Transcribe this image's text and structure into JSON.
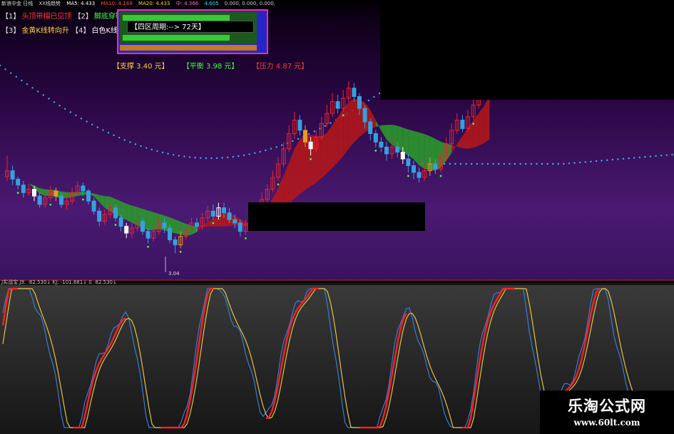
{
  "toolbar": {
    "parts": [
      {
        "text": "新浪中金 日线",
        "color": "#dddddd"
      },
      {
        "text": "XX线趋势",
        "color": "#dddddd"
      },
      {
        "text": "MA5: 4.433",
        "color": "#ffffff"
      },
      {
        "text": "MA10: 4.169",
        "color": "#ff4a4a"
      },
      {
        "text": "MA20: 4.433",
        "color": "#ffd700"
      },
      {
        "text": "中: 4.366",
        "color": "#ff66cc"
      },
      {
        "text": "4.605",
        "color": "#00e5ff"
      },
      {
        "text": "0.000, 0.000, 0.000,",
        "color": "#cccccc"
      }
    ]
  },
  "legend": [
    {
      "key": "【1】",
      "text": "头顶带帽已见顶",
      "color": "#ff3b3b"
    },
    {
      "key": "【2】",
      "text": "脚底穿鞋跌势",
      "color": "#3cff3c"
    },
    {
      "key": "【3】",
      "text": "金黄K线转向升",
      "color": "#ffd23a"
    },
    {
      "key": "【4】",
      "text": "白色K线转向跌",
      "color": "#ffffff"
    }
  ],
  "cycle": {
    "label": "【四区周期:-->  72天】"
  },
  "levels": [
    {
      "text": "【支撑 3.40 元】",
      "color": "#ffd23a"
    },
    {
      "text": "【平衡 3.98 元】",
      "color": "#3cff3c"
    },
    {
      "text": "【压力 4.87 元】",
      "color": "#ff3b3b"
    }
  ],
  "low_mark": "3.04",
  "oscillator": {
    "label": "J实战宝 J9: -82.530↓ KJ: -101.681↓ 0 -82.530↓"
  },
  "watermark": {
    "title": "乐淘公式网",
    "url": "www.60lt.com"
  },
  "colors": {
    "up": "#e8242f",
    "down": "#35a0e0",
    "white": "#ffffff",
    "gold": "#e89a28",
    "ribbon_bull": "#b81818",
    "ribbon_bear": "#2aa02a",
    "dots": "#3ab0ff",
    "osc_red": "#ff2020",
    "osc_blue": "#3a7ad8",
    "osc_yellow": "#e8c23a"
  },
  "chart_data": {
    "type": "candlestick",
    "title": "",
    "price_range": [
      2.9,
      5.2
    ],
    "candles": [
      [
        3.95,
        4.02,
        4.2,
        3.9
      ],
      [
        4.02,
        3.92,
        4.08,
        3.85
      ],
      [
        3.92,
        3.85,
        3.95,
        3.8
      ],
      [
        3.85,
        3.76,
        3.9,
        3.7
      ],
      [
        3.76,
        3.8,
        3.86,
        3.72
      ],
      [
        3.8,
        3.72,
        3.84,
        3.66
      ],
      [
        3.72,
        3.62,
        3.76,
        3.58
      ],
      [
        3.62,
        3.7,
        3.76,
        3.58
      ],
      [
        3.7,
        3.78,
        3.84,
        3.66
      ],
      [
        3.78,
        3.72,
        3.82,
        3.66
      ],
      [
        3.72,
        3.62,
        3.76,
        3.58
      ],
      [
        3.62,
        3.66,
        3.72,
        3.56
      ],
      [
        3.66,
        3.76,
        3.82,
        3.62
      ],
      [
        3.76,
        3.84,
        3.9,
        3.72
      ],
      [
        3.84,
        3.78,
        3.88,
        3.72
      ],
      [
        3.78,
        3.66,
        3.8,
        3.62
      ],
      [
        3.66,
        3.54,
        3.7,
        3.5
      ],
      [
        3.54,
        3.42,
        3.58,
        3.36
      ],
      [
        3.42,
        3.5,
        3.56,
        3.38
      ],
      [
        3.5,
        3.58,
        3.64,
        3.46
      ],
      [
        3.58,
        3.46,
        3.62,
        3.42
      ],
      [
        3.46,
        3.36,
        3.5,
        3.3
      ],
      [
        3.36,
        3.28,
        3.4,
        3.22
      ],
      [
        3.28,
        3.34,
        3.4,
        3.22
      ],
      [
        3.34,
        3.42,
        3.48,
        3.3
      ],
      [
        3.42,
        3.3,
        3.46,
        3.26
      ],
      [
        3.3,
        3.22,
        3.34,
        3.16
      ],
      [
        3.22,
        3.3,
        3.38,
        3.18
      ],
      [
        3.3,
        3.4,
        3.46,
        3.26
      ],
      [
        3.4,
        3.34,
        3.46,
        3.28
      ],
      [
        3.34,
        3.2,
        3.38,
        3.16
      ],
      [
        3.2,
        3.14,
        3.24,
        3.04
      ],
      [
        3.14,
        3.24,
        3.3,
        3.1
      ],
      [
        3.24,
        3.32,
        3.38,
        3.2
      ],
      [
        3.32,
        3.4,
        3.46,
        3.28
      ],
      [
        3.4,
        3.36,
        3.46,
        3.3
      ],
      [
        3.36,
        3.46,
        3.52,
        3.32
      ],
      [
        3.46,
        3.54,
        3.6,
        3.42
      ],
      [
        3.54,
        3.48,
        3.62,
        3.44
      ],
      [
        3.48,
        3.58,
        3.64,
        3.44
      ],
      [
        3.58,
        3.52,
        3.64,
        3.46
      ],
      [
        3.52,
        3.44,
        3.58,
        3.4
      ],
      [
        3.44,
        3.4,
        3.5,
        3.34
      ],
      [
        3.4,
        3.3,
        3.44,
        3.24
      ],
      [
        3.3,
        3.38,
        3.44,
        3.26
      ],
      [
        3.38,
        3.46,
        3.52,
        3.34
      ],
      [
        3.46,
        3.56,
        3.62,
        3.42
      ],
      [
        3.56,
        3.68,
        3.76,
        3.52
      ],
      [
        3.68,
        3.8,
        3.86,
        3.64
      ],
      [
        3.8,
        3.94,
        4.02,
        3.76
      ],
      [
        3.94,
        4.1,
        4.18,
        3.9
      ],
      [
        4.1,
        4.28,
        4.36,
        4.06
      ],
      [
        4.28,
        4.46,
        4.56,
        4.24
      ],
      [
        4.46,
        4.62,
        4.72,
        4.4
      ],
      [
        4.62,
        4.5,
        4.68,
        4.44
      ],
      [
        4.5,
        4.36,
        4.56,
        4.3
      ],
      [
        4.36,
        4.28,
        4.42,
        4.2
      ],
      [
        4.28,
        4.42,
        4.5,
        4.24
      ],
      [
        4.42,
        4.58,
        4.66,
        4.38
      ],
      [
        4.58,
        4.7,
        4.8,
        4.54
      ],
      [
        4.7,
        4.84,
        4.94,
        4.66
      ],
      [
        4.84,
        4.76,
        4.92,
        4.7
      ],
      [
        4.76,
        4.88,
        4.98,
        4.72
      ],
      [
        4.88,
        5.0,
        5.08,
        4.84
      ],
      [
        5.0,
        4.9,
        5.06,
        4.84
      ],
      [
        4.9,
        4.76,
        4.94,
        4.68
      ],
      [
        4.76,
        4.6,
        4.8,
        4.52
      ],
      [
        4.6,
        4.46,
        4.64,
        4.38
      ],
      [
        4.46,
        4.36,
        4.5,
        4.3
      ],
      [
        4.36,
        4.3,
        4.42,
        4.24
      ],
      [
        4.3,
        4.22,
        4.36,
        4.14
      ],
      [
        4.22,
        4.3,
        4.38,
        4.16
      ],
      [
        4.3,
        4.24,
        4.36,
        4.18
      ],
      [
        4.24,
        4.16,
        4.3,
        4.1
      ],
      [
        4.16,
        4.08,
        4.22,
        4.0
      ],
      [
        4.08,
        4.0,
        4.14,
        3.92
      ],
      [
        4.0,
        3.94,
        4.06,
        3.88
      ],
      [
        3.94,
        4.02,
        4.1,
        3.9
      ],
      [
        4.02,
        4.1,
        4.18,
        3.96
      ],
      [
        4.1,
        4.04,
        4.16,
        3.98
      ],
      [
        4.04,
        4.18,
        4.26,
        4.0
      ],
      [
        4.18,
        4.34,
        4.42,
        4.14
      ],
      [
        4.34,
        4.5,
        4.58,
        4.3
      ],
      [
        4.5,
        4.62,
        4.7,
        4.46
      ],
      [
        4.62,
        4.52,
        4.68,
        4.48
      ],
      [
        4.52,
        4.66,
        4.74,
        4.48
      ],
      [
        4.66,
        4.8,
        4.88,
        4.62
      ],
      [
        4.8,
        4.92,
        5.0,
        4.76
      ],
      [
        4.92,
        5.04,
        5.12,
        4.88
      ],
      [
        5.04,
        5.14,
        5.2,
        5.0
      ]
    ]
  }
}
